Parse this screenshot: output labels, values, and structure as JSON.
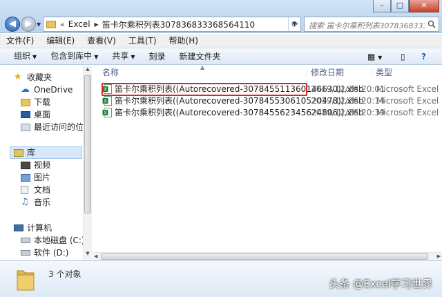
{
  "address": {
    "crumbs": [
      "Excel",
      "笛卡尔乘积列表307836833368564110"
    ],
    "search_placeholder": "搜索 笛卡尔乘积列表307836833368..."
  },
  "menu": [
    "文件(F)",
    "编辑(E)",
    "查看(V)",
    "工具(T)",
    "帮助(H)"
  ],
  "toolbar": {
    "organize": "组织",
    "include": "包含到库中",
    "share": "共享",
    "burn": "刻录",
    "new_folder": "新建文件夹"
  },
  "nav": {
    "favorites": "收藏夹",
    "onedrive": "OneDrive",
    "downloads": "下载",
    "desktop": "桌面",
    "recent": "最近访问的位置",
    "libraries": "库",
    "videos": "视频",
    "pictures": "图片",
    "documents": "文档",
    "music": "音乐",
    "computer": "计算机",
    "local_disk": "本地磁盘 (C:)",
    "soft_disk": "软件 (D:)"
  },
  "columns": {
    "name": "名称",
    "date": "修改日期",
    "type": "类型"
  },
  "files": [
    {
      "name": "笛卡尔乘积列表((Autorecovered-307845511360146630)).xlsb",
      "date": "2019/12/26 20:01",
      "type": "Microsoft Excel ..."
    },
    {
      "name": "笛卡尔乘积列表((Autorecovered-307845530610520478)).xlsb",
      "date": "2019/12/26 20:14",
      "type": "Microsoft Excel ..."
    },
    {
      "name": "笛卡尔乘积列表((Autorecovered-307845562345624806)).xlsb",
      "date": "2019/12/26 20:39",
      "type": "Microsoft Excel ..."
    }
  ],
  "status": {
    "count": "3 个对象"
  },
  "watermark": "头条 @Excel学习世界",
  "colors": {
    "highlight": "#d8262a",
    "excel_green": "#1f7a3a"
  }
}
